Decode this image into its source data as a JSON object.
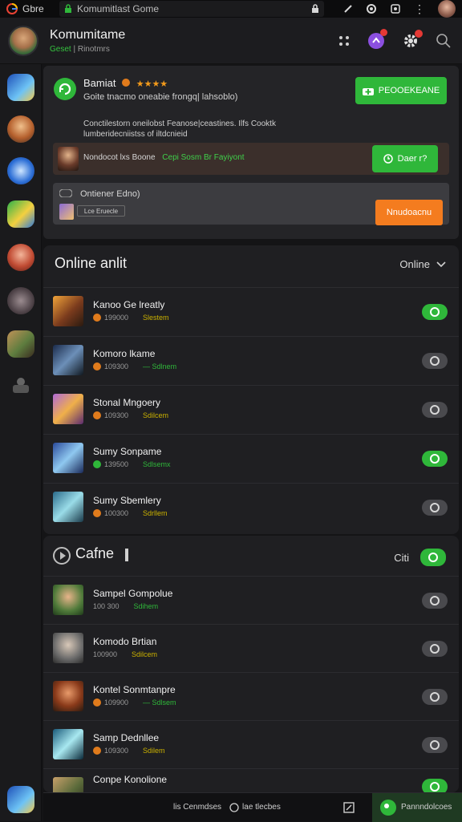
{
  "statusbar": {
    "app_label": "Gbre",
    "url": "Komumitlast Gome",
    "icons": [
      "google-icon",
      "lock-icon",
      "edit-icon",
      "circle-icon",
      "shield-icon",
      "more-icon",
      "profile-icon"
    ]
  },
  "header": {
    "title": "Komumitame",
    "subtitle_green": "Geset",
    "subtitle_rest": "| Rinotmrs",
    "icons": [
      "grid-icon",
      "chat-icon",
      "settings-icon",
      "search-icon"
    ]
  },
  "colors": {
    "accent_green": "#2fb73a",
    "accent_orange": "#f47c1f",
    "bg": "#141416",
    "panel": "#242427"
  },
  "promo": {
    "title": "Bamiat",
    "stars": "★★★★",
    "desc": "Goite tnacmo oneabie frongq| lahsoblo)",
    "button": "PEOOEKEANE",
    "text_line1": "Conctilestorn oneilobst Feanose|ceastines. Ilfs Cooktk",
    "text_line2": "lumberidecniistss of iltdcnieid"
  },
  "invite": {
    "label": "Nondocot lxs Boone",
    "label_green": "Cepi Sosm Br Fayiyont",
    "button": "Daer r?"
  },
  "status_row": {
    "title": "Ontiener Edno)",
    "tag": "Lce  Eruecle",
    "button": "Nnudoacnu"
  },
  "section1": {
    "title": "Online anlit",
    "dropdown": "Online",
    "rows": [
      {
        "name": "Kanoo Ge lreatly",
        "count": "199000",
        "note": "Slestem",
        "on": true
      },
      {
        "name": "Komoro lkame",
        "count": "109300",
        "note": "— Sdlnem",
        "on": false
      },
      {
        "name": "Stonal Mngoery",
        "count": "109300",
        "note": "Sdilcem",
        "on": false
      },
      {
        "name": "Sumy Sonpame",
        "count": "139500",
        "note": "Sdlsemx",
        "on": true
      },
      {
        "name": "Sumy Sbemlery",
        "count": "100300",
        "note": "Sdrllem",
        "on": false
      }
    ]
  },
  "section2": {
    "title": "Cafne",
    "right_label": "Citi",
    "rows": [
      {
        "name": "Sampel Gompolue",
        "count": "100 300",
        "note": "Sdihem",
        "on": false
      },
      {
        "name": "Komodo Brtian",
        "count": "100900",
        "note": "Sdilcem",
        "on": false
      },
      {
        "name": "Kontel Sonmtanpre",
        "count": "109900",
        "note": "— Sdlsem",
        "on": false
      },
      {
        "name": "Samp Dednllee",
        "count": "109300",
        "note": "Sdilem",
        "on": false
      },
      {
        "name": "Conpe Konolione",
        "count": "",
        "note": "",
        "on": true
      }
    ]
  },
  "bottombar": {
    "left": "lis Cenmdses",
    "middle": "lae tlecbes",
    "pill": "Pannndolcoes"
  }
}
